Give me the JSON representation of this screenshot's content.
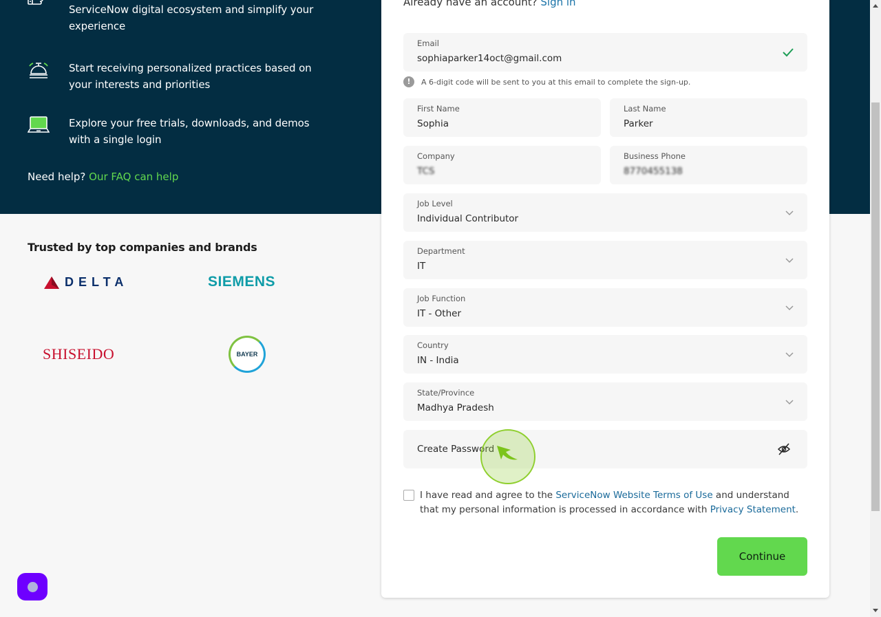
{
  "hero": {
    "features": [
      {
        "icon": "thumbs-up-icon",
        "text": "ServiceNow digital ecosystem and simplify your experience"
      },
      {
        "icon": "service-bell-icon",
        "text": "Start receiving personalized practices based on your interests and priorities"
      },
      {
        "icon": "laptop-icon",
        "text": "Explore your free trials, downloads, and demos with a single login"
      }
    ],
    "help_text": "Need help?",
    "help_link": "Our FAQ can help"
  },
  "trusted": {
    "heading": "Trusted by top companies and brands",
    "logos": [
      "DELTA",
      "SIEMENS",
      "SHISEIDO",
      "BAYER"
    ]
  },
  "form": {
    "already_text": "Already have an account?",
    "sign_in_link": "Sign in",
    "email": {
      "label": "Email",
      "value": "sophiaparker14oct@gmail.com",
      "status": "valid"
    },
    "email_note": "A 6-digit code will be sent to you at this email to complete the sign-up.",
    "first_name": {
      "label": "First Name",
      "value": "Sophia"
    },
    "last_name": {
      "label": "Last Name",
      "value": "Parker"
    },
    "company": {
      "label": "Company",
      "value": "TCS"
    },
    "business_phone": {
      "label": "Business Phone",
      "value": "8770455138"
    },
    "job_level": {
      "label": "Job Level",
      "value": "Individual Contributor"
    },
    "department": {
      "label": "Department",
      "value": "IT"
    },
    "job_function": {
      "label": "Job Function",
      "value": "IT - Other"
    },
    "country": {
      "label": "Country",
      "value": "IN - India"
    },
    "state": {
      "label": "State/Province",
      "value": "Madhya Pradesh"
    },
    "password": {
      "placeholder": "Create Password"
    },
    "consent": {
      "prefix": "I have read and agree to the ",
      "terms_link": "ServiceNow Website Terms of Use",
      "middle": " and understand that my personal information is processed in accordance with ",
      "privacy_link": "Privacy Statement",
      "suffix": ".",
      "checked": false
    },
    "continue_label": "Continue"
  },
  "colors": {
    "hero_bg": "#032d42",
    "accent_green": "#62d84e",
    "link_blue": "#1a73a8",
    "chat_purple": "#6e00ff"
  }
}
